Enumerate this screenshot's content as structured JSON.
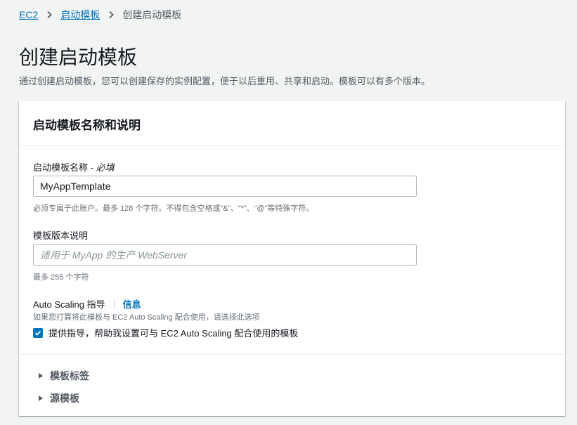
{
  "breadcrumb": {
    "items": [
      "EC2",
      "启动模板"
    ],
    "current": "创建启动模板"
  },
  "page": {
    "title": "创建启动模板",
    "description": "通过创建启动模板，您可以创建保存的实例配置，便于以后重用、共享和启动。模板可以有多个版本。"
  },
  "panel": {
    "title": "启动模板名称和说明",
    "name_field": {
      "label": "启动模板名称 - ",
      "required": "必填",
      "value": "MyAppTemplate",
      "hint": "必须专属于此账户。最多 128 个字符。不得包含空格或“&”、“*”、“@”等特殊字符。"
    },
    "desc_field": {
      "label": "模板版本说明",
      "placeholder": "适用于 MyApp 的生产 WebServer",
      "hint": "最多 255 个字符"
    },
    "auto_scaling": {
      "label": "Auto Scaling 指导",
      "info": "信息",
      "hint": "如果您打算将此模板与 EC2 Auto Scaling 配合使用，请选择此选项",
      "checkbox_label": "提供指导，帮助我设置可与 EC2 Auto Scaling 配合使用的模板",
      "checked": true
    },
    "expanders": [
      "模板标签",
      "源模板"
    ]
  },
  "colors": {
    "link": "#0073bb",
    "background": "#f2f3f3"
  }
}
